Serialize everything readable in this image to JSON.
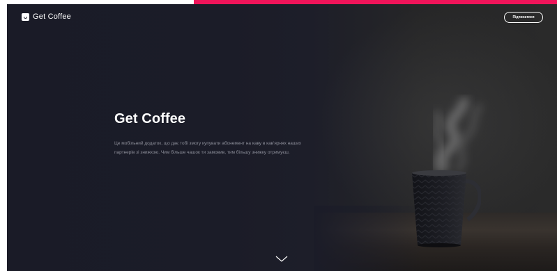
{
  "nav": {
    "brand": "Get Coffee",
    "subscribe_label": "Підписатися"
  },
  "hero": {
    "title": "Get Coffee",
    "description": "Це мобільний додаток, що дає тобі змогу купувати абонемент на каву в кав'ярнях наших партнерів зі знижкою. Чим більше чашок ти замовив, тим більшу знижку отримуєш."
  },
  "colors": {
    "accent_bar": "#f0145a",
    "hero_background": "#1a1b27",
    "text_primary": "#ffffff",
    "text_secondary": "#8f919c"
  },
  "icons": {
    "logo": "coffee-cup-icon",
    "scroll_down": "chevron-down-icon"
  }
}
